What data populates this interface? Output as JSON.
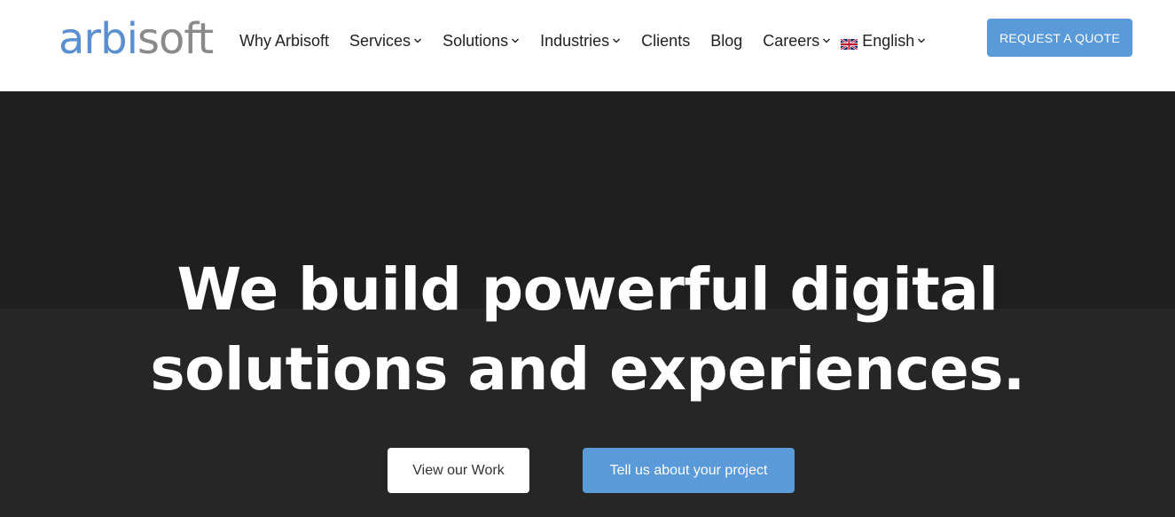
{
  "header": {
    "logo_part1": "arbi",
    "logo_part2": "soft",
    "nav": [
      {
        "label": "Why Arbisoft",
        "dropdown": false
      },
      {
        "label": "Services",
        "dropdown": true
      },
      {
        "label": "Solutions",
        "dropdown": true
      },
      {
        "label": "Industries",
        "dropdown": true
      },
      {
        "label": "Clients",
        "dropdown": false
      },
      {
        "label": "Blog",
        "dropdown": false
      },
      {
        "label": "Careers",
        "dropdown": true
      }
    ],
    "language": {
      "label": "English",
      "flag": "uk-flag-icon"
    },
    "cta_label": "REQUEST A QUOTE"
  },
  "hero": {
    "headline_line1": "We build powerful digital",
    "headline_line2": "solutions and experiences.",
    "primary_button": "View our Work",
    "secondary_button": "Tell us about your project"
  },
  "colors": {
    "accent": "#5a9ad9",
    "hero_bg": "#1f1f1f",
    "logo_blue": "#5a8fd0",
    "logo_gray": "#8a8a8a"
  }
}
